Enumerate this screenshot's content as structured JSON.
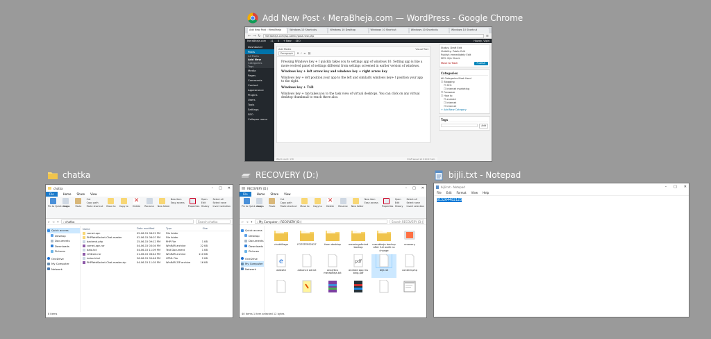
{
  "windows": {
    "chrome": {
      "title": "Add New Post ‹ MeraBheja.com — WordPress - Google Chrome",
      "tabs": [
        "Add New Post ‹ MeraBheja",
        "Windows 10 Shortcuts",
        "Windows 10 Desktop",
        "Windows 10 Shortcut",
        "Windows 10 Shortcuts",
        "Windows 10 Shortcut"
      ],
      "url": "merabheja.com/wp-admin/post-new.php",
      "adminbar": [
        "MeraBheja.com",
        "11",
        "0",
        "+ New",
        "SEO",
        "Howdy, Vipin"
      ],
      "menu": [
        "Dashboard",
        "Posts",
        "All Posts",
        "Add New",
        "Categories",
        "Tags",
        "Media",
        "Pages",
        "Comments",
        "Contact",
        "Appearance",
        "Plugins",
        "Users",
        "Tools",
        "Settings",
        "SEO",
        "Collapse menu"
      ],
      "editor_toolbar": "Add Media",
      "paragraph_format": "Paragraph",
      "mode_tabs": "Visual   Text",
      "paragraphs": [
        {
          "bold": "",
          "text": "Pressing Windows key + I quickly takes you to settings app of windows 10. Setting app is like a more evolved panel of settings different from settings screened in earlier version of windows."
        },
        {
          "bold": "Windows key + left arrow key and windows key + right arrow key",
          "text": ""
        },
        {
          "bold": "",
          "text": "Windows key + left position your app to the left and similarly windows key+ t position your app to the right."
        },
        {
          "bold": "Windows key + TAB",
          "text": ""
        },
        {
          "bold": "",
          "text": "Windows key + tab takes you to the task view of virtual desktops. You can click on any virtual desktop thumbnail to reach there also."
        }
      ],
      "word_count": "Word count: 170",
      "draft_saved": "Draft saved at 4:10:23 am.",
      "publish_box": {
        "status": "Status: Draft Edit",
        "visibility": "Visibility: Public Edit",
        "schedule": "Publish immediately Edit",
        "seo": "SEO: N/A Check",
        "trash": "Move to Trash",
        "publish": "Publish"
      },
      "categories_box": {
        "title": "Categories",
        "tabs": "All Categories   Most Used",
        "items": [
          "Blogging",
          "SEO",
          "Internet marketing",
          "Freeware",
          "How to",
          "android",
          "Internet",
          "Internet"
        ],
        "add": "+ Add New Category"
      },
      "tags_box": {
        "title": "Tags",
        "add": "Add"
      }
    },
    "explorer1": {
      "title": "chatka",
      "tabs": [
        "File",
        "Home",
        "Share",
        "View"
      ],
      "ribbon": {
        "pin": "Pin to Quick access",
        "copy": "Copy",
        "paste": "Paste",
        "cut": "Cut",
        "copy_path": "Copy path",
        "paste_shortcut": "Paste shortcut",
        "move_to": "Move to",
        "copy_to": "Copy to",
        "delete": "Delete",
        "rename": "Rename",
        "new_folder": "New folder",
        "new_item": "New item",
        "easy_access": "Easy access",
        "properties": "Properties",
        "open": "Open",
        "edit": "Edit",
        "history": "History",
        "select_all": "Select all",
        "select_none": "Select none",
        "invert": "Invert selection"
      },
      "address": "› chatka",
      "search": "Search chatka",
      "nav": [
        "Quick access",
        "Desktop",
        "Documents",
        "Downloads",
        "Pictures",
        "OneDrive",
        "My Computer",
        "Network"
      ],
      "columns": [
        "Name",
        "Date modified",
        "Type",
        "Size"
      ],
      "rows": [
        {
          "name": "comet-apn",
          "date": "05-06-15 08:22 PM",
          "type": "File folder",
          "size": ""
        },
        {
          "name": "PHPWebSocket-Chat-master",
          "date": "02-06-15 08:07 PM",
          "type": "File folder",
          "size": ""
        },
        {
          "name": "backend.php",
          "date": "25-06-15 09:12 PM",
          "type": "PHP File",
          "size": "1 KB"
        },
        {
          "name": "comet-apn.rar",
          "date": "04-06-15 03:04 PM",
          "type": "WinRAR archive",
          "size": "22 KB"
        },
        {
          "name": "data.txt",
          "date": "04-06-15 11:09 PM",
          "type": "Text Document",
          "size": "1 KB"
        },
        {
          "name": "ref4tom.rar",
          "date": "21-06-15 06:44 PM",
          "type": "WinRAR archive",
          "size": "110 KB"
        },
        {
          "name": "index.html",
          "date": "26-06-15 09:46 PM",
          "type": "HTML File",
          "size": "2 KB"
        },
        {
          "name": "PHPWebSocket-Chat-master.zip",
          "date": "04-06-15 11:05 PM",
          "type": "WinRAR ZIP archive",
          "size": "16 KB"
        }
      ],
      "status": "8 items"
    },
    "explorer2": {
      "title": "RECOVERY (D:)",
      "tabs": [
        "File",
        "Home",
        "Share",
        "View"
      ],
      "address": "› My Computer › RECOVERY (D:)",
      "search": "Search RECOVERY (D:)",
      "nav": [
        "Quick access",
        "Desktop",
        "Documents",
        "Downloads",
        "Pictures",
        "OneDrive",
        "My Computer",
        "Network"
      ],
      "tiles": [
        {
          "name": "chatkillage",
          "kind": "folder"
        },
        {
          "name": "FOTSTEPS2027",
          "kind": "folder"
        },
        {
          "name": "from desktop",
          "kind": "folder"
        },
        {
          "name": "meaningofmind backup",
          "kind": "folder"
        },
        {
          "name": "merabheja backup after full audit no change",
          "kind": "folder"
        },
        {
          "name": "recovery",
          "kind": "app"
        },
        {
          "name": "website",
          "kind": "edge"
        },
        {
          "name": "advance ad.txt",
          "kind": "doc"
        },
        {
          "name": "analytics merabheja.txt",
          "kind": "doc"
        },
        {
          "name": "android app ms bing.pdf",
          "kind": "pdf"
        },
        {
          "name": "bijli.txt",
          "kind": "doc"
        },
        {
          "name": "content.php",
          "kind": "doc"
        },
        {
          "name": "",
          "kind": "doc"
        },
        {
          "name": "",
          "kind": "note"
        },
        {
          "name": "",
          "kind": "winrar"
        },
        {
          "name": "",
          "kind": "winrar2"
        },
        {
          "name": "",
          "kind": "doc"
        },
        {
          "name": "",
          "kind": "screen"
        }
      ],
      "status": "40 items   1 item selected  12 bytes"
    },
    "notepad": {
      "title": "bijli.txt - Notepad",
      "inner_title": "bijli.txt - Notepad",
      "menu": [
        "File",
        "Edit",
        "Format",
        "View",
        "Help"
      ],
      "content": "813264482123"
    }
  },
  "colors": {
    "desktop": "#9a9a9a",
    "wp_dark": "#23282d",
    "wp_blue": "#0073aa",
    "win_blue": "#1979ca",
    "folder": "#f8d775"
  }
}
